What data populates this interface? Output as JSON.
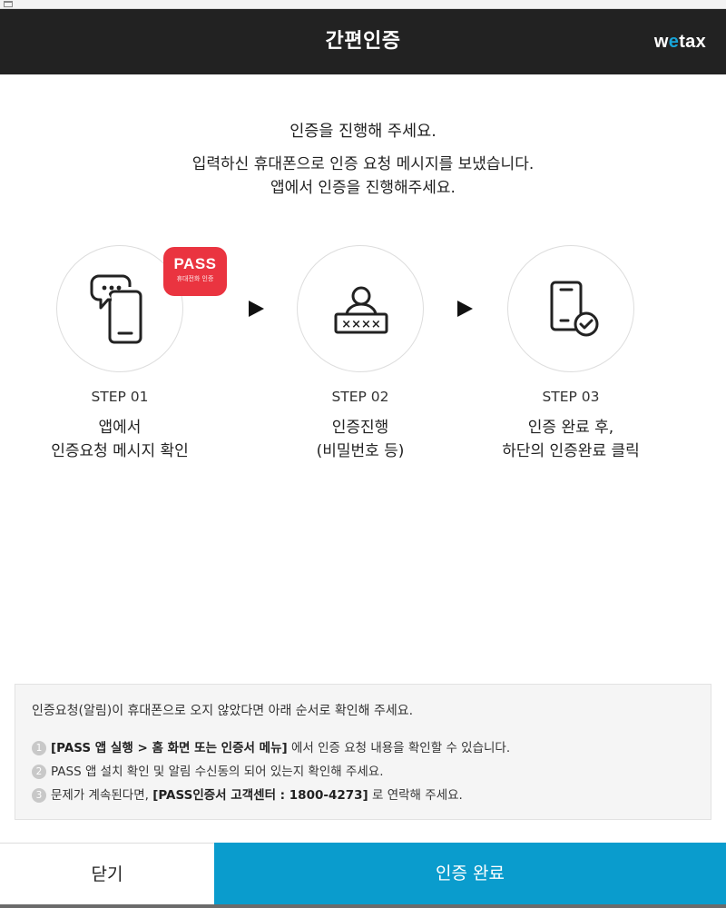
{
  "header": {
    "title": "간편인증",
    "logo_pre": "w",
    "logo_mid": "e",
    "logo_post": "tax"
  },
  "intro": {
    "line1": "인증을 진행해 주세요.",
    "line2": "입력하신 휴대폰으로 인증 요청 메시지를 보냈습니다.",
    "line3": "앱에서 인증을 진행해주세요."
  },
  "badge": {
    "title": "PASS",
    "subtitle": "휴대전화 인증"
  },
  "steps": [
    {
      "number": "STEP 01",
      "desc1": "앱에서",
      "desc2": "인증요청 메시지 확인",
      "icon": "phone-chat-icon"
    },
    {
      "number": "STEP 02",
      "desc1": "인증진행",
      "desc2": "(비밀번호 등)",
      "icon": "user-password-icon"
    },
    {
      "number": "STEP 03",
      "desc1": "인증 완료 후,",
      "desc2": "하단의 인증완료 클릭",
      "icon": "phone-check-icon"
    }
  ],
  "notice": {
    "lead": "인증요청(알림)이 휴대폰으로 오지 않았다면 아래 순서로 확인해 주세요.",
    "items": [
      {
        "num": "1",
        "bold": "[PASS 앱 실행 > 홈 화면 또는 인증서 메뉴]",
        "text": " 에서 인증 요청 내용을 확인할 수 있습니다."
      },
      {
        "num": "2",
        "bold": "",
        "text": "PASS 앱 설치 확인 및 알림 수신동의 되어 있는지 확인해 주세요."
      },
      {
        "num": "3",
        "pre": "문제가 계속된다면, ",
        "bold": "[PASS인증서 고객센터 : 1800-4273]",
        "text": " 로 연락해 주세요."
      }
    ]
  },
  "footer": {
    "close_label": "닫기",
    "done_label": "인증 완료",
    "accent_color": "#0a9ccd"
  }
}
